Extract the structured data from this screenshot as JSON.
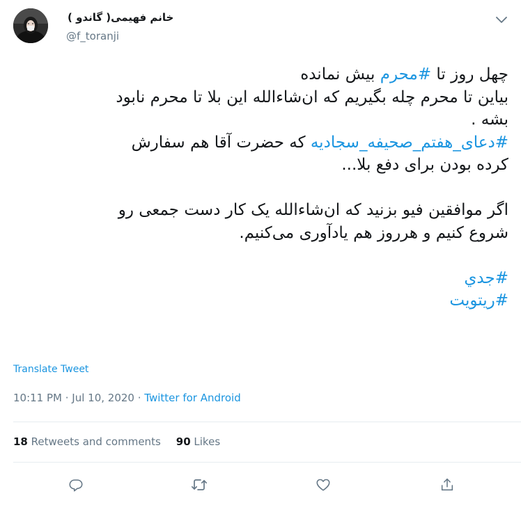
{
  "user": {
    "display_name": "خانم فهیمی( گاندو )",
    "handle": "@f_toranji"
  },
  "tweet": {
    "line1_pre": "چهل روز تا ",
    "line1_tag": "#محرم",
    "line1_post": " بیش نمانده",
    "line2": "بیاین تا محرم چله بگیریم که ان‌شاءالله این بلا تا محرم نابود",
    "line3": "بشه .",
    "line4_tag": "#دعای_هفتم_صحیفه_سجادیه",
    "line4_post": " که حضرت آقا هم سفارش",
    "line5": "کرده بودن برای دفع بلا...",
    "line6": "اگر موافقین فیو بزنید که ان‌شاءالله یک کار دست جمعی رو",
    "line7": "شروع کنیم و هرروز هم یادآوری می‌کنیم.",
    "tag_jeddi": "#جدي",
    "tag_retweet": "#ریتویت"
  },
  "translate_label": "Translate Tweet",
  "meta": {
    "time": "10:11 PM",
    "separator": " · ",
    "date": "Jul 10, 2020",
    "source": "Twitter for Android"
  },
  "stats": {
    "retweets_count": "18",
    "retweets_label": " Retweets and comments",
    "likes_count": "90",
    "likes_label": " Likes"
  },
  "colors": {
    "link": "#1b95e0",
    "secondary": "#657786",
    "divider": "#e6ecf0"
  },
  "icons": [
    "chevron-down-icon",
    "reply-icon",
    "retweet-icon",
    "like-icon",
    "share-icon"
  ]
}
